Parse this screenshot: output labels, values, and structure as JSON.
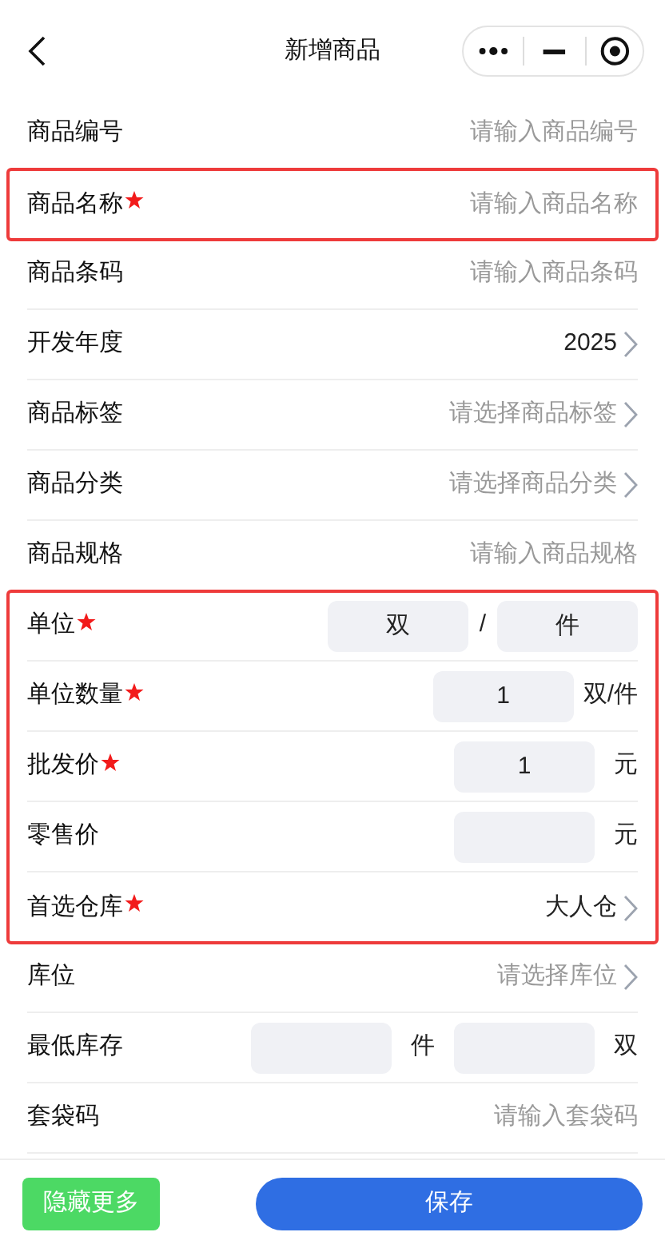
{
  "header": {
    "title": "新增商品"
  },
  "sections": [
    {
      "highlighted": false,
      "rows": [
        {
          "kind": "input",
          "label": "商品编号",
          "required": false,
          "placeholder": "请输入商品编号"
        }
      ]
    },
    {
      "highlighted": true,
      "rows": [
        {
          "kind": "input",
          "label": "商品名称",
          "required": true,
          "placeholder": "请输入商品名称"
        }
      ]
    },
    {
      "highlighted": false,
      "rows": [
        {
          "kind": "input",
          "label": "商品条码",
          "required": false,
          "placeholder": "请输入商品条码"
        },
        {
          "kind": "select",
          "label": "开发年度",
          "required": false,
          "value": "2025"
        },
        {
          "kind": "select",
          "label": "商品标签",
          "required": false,
          "placeholder": "请选择商品标签"
        },
        {
          "kind": "select",
          "label": "商品分类",
          "required": false,
          "placeholder": "请选择商品分类"
        },
        {
          "kind": "input",
          "label": "商品规格",
          "required": false,
          "placeholder": "请输入商品规格"
        }
      ]
    },
    {
      "highlighted": true,
      "rows": [
        {
          "kind": "pair",
          "label": "单位",
          "required": true,
          "value": "双",
          "separator": "/",
          "value2": "件"
        },
        {
          "kind": "box",
          "label": "单位数量",
          "required": true,
          "value": "1",
          "unit": "双/件"
        },
        {
          "kind": "box",
          "label": "批发价",
          "required": true,
          "value": "1",
          "unit": "元"
        },
        {
          "kind": "box",
          "label": "零售价",
          "required": false,
          "unit": "元"
        },
        {
          "kind": "select",
          "label": "首选仓库",
          "required": true,
          "value": "大人仓"
        }
      ]
    },
    {
      "highlighted": false,
      "rows": [
        {
          "kind": "select",
          "label": "库位",
          "required": false,
          "placeholder": "请选择库位"
        },
        {
          "kind": "double",
          "label": "最低库存",
          "required": false,
          "unit": "件",
          "unit2": "双"
        },
        {
          "kind": "input",
          "label": "套袋码",
          "required": false,
          "placeholder": "请输入套袋码"
        }
      ]
    }
  ],
  "footer": {
    "secondary": "隐藏更多",
    "primary": "保存"
  }
}
